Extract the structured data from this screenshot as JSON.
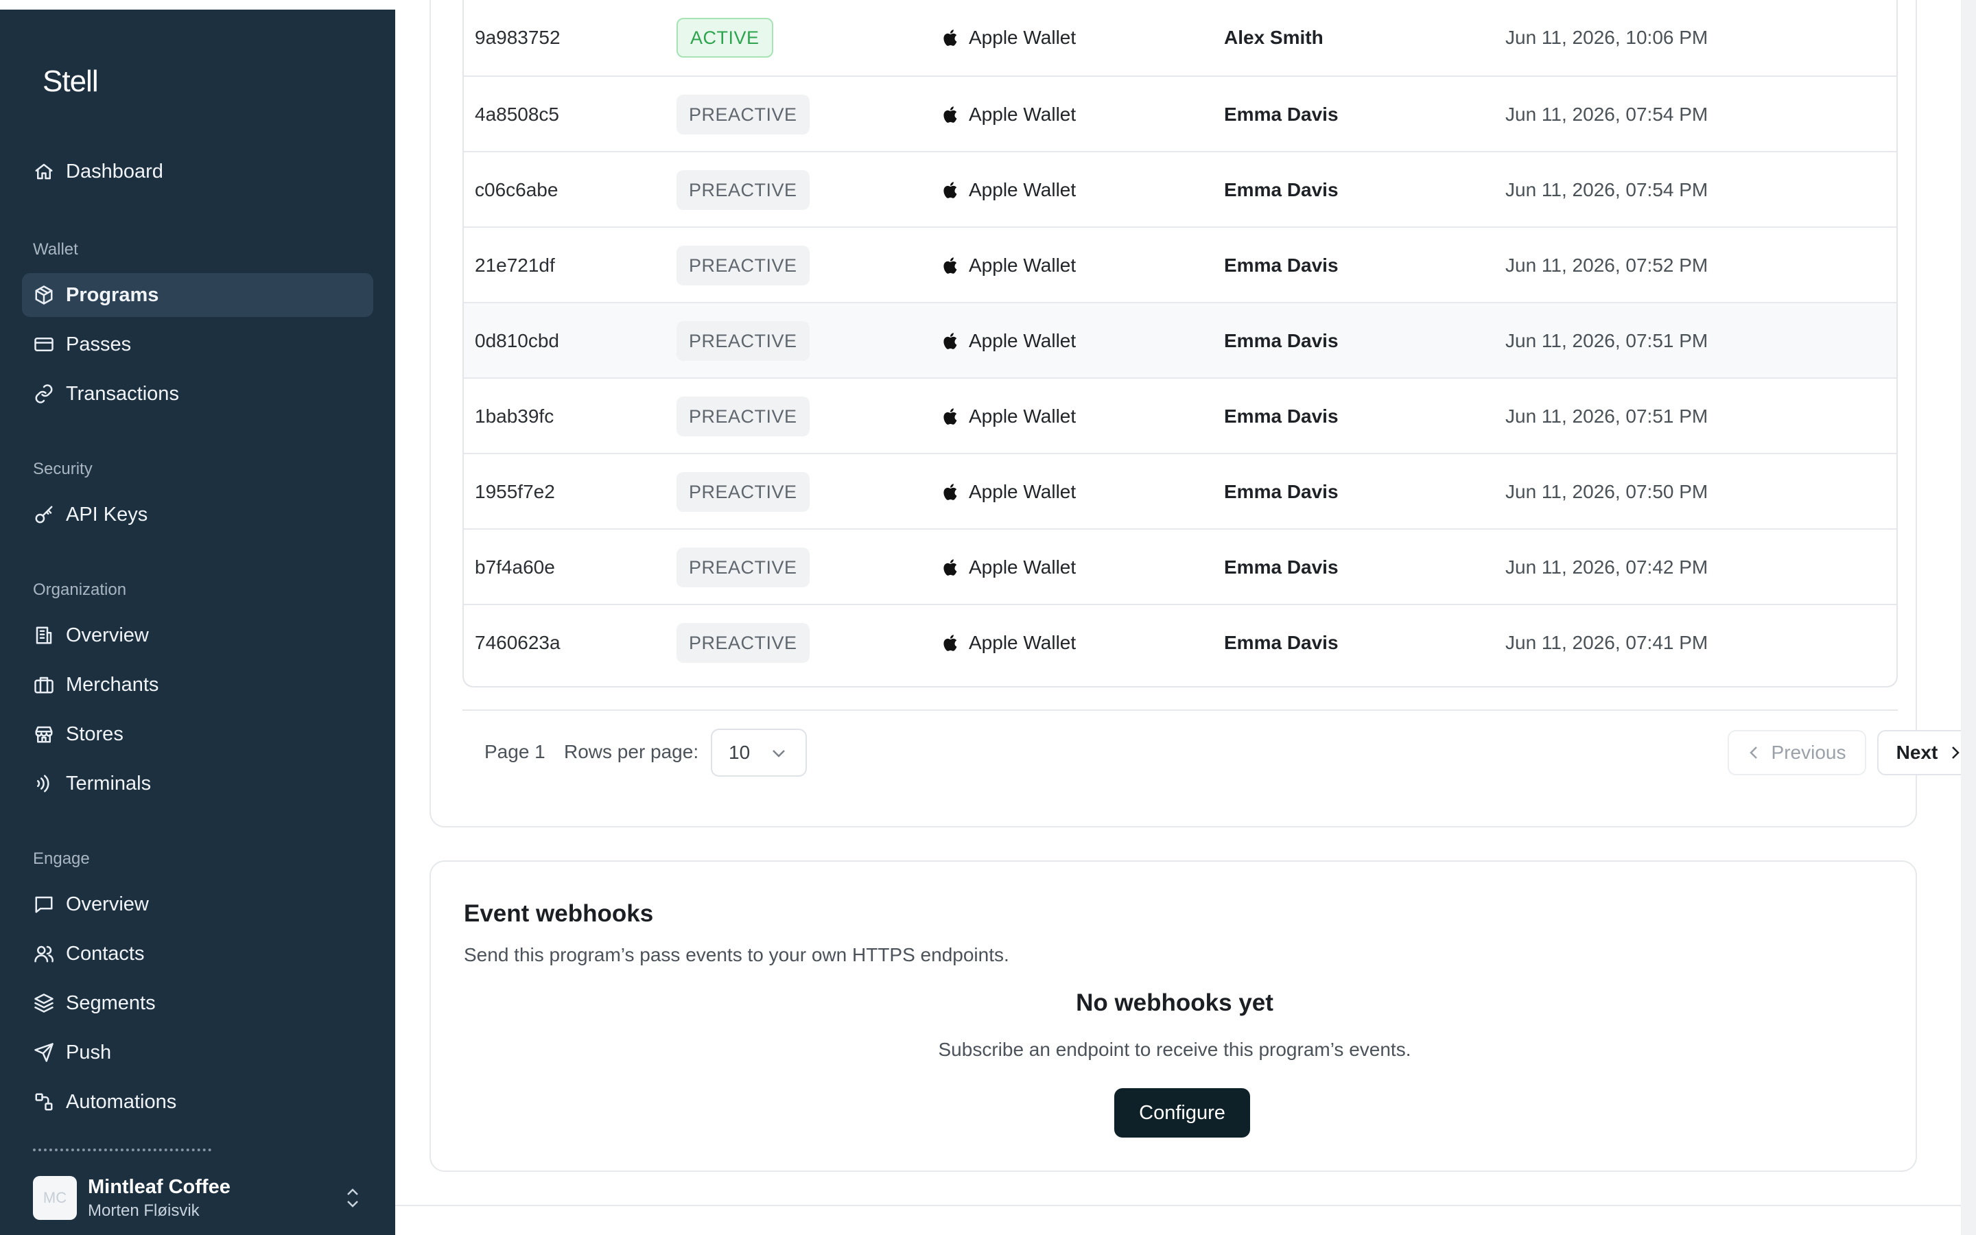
{
  "app": {
    "logo": "Stell"
  },
  "sidebar": {
    "dashboard": "Dashboard",
    "sections": {
      "wallet": "Wallet",
      "security": "Security",
      "organization": "Organization",
      "engage": "Engage"
    },
    "wallet_items": [
      "Programs",
      "Passes",
      "Transactions"
    ],
    "security_items": [
      "API Keys"
    ],
    "organization_items": [
      "Overview",
      "Merchants",
      "Stores",
      "Terminals"
    ],
    "engage_items": [
      "Overview",
      "Contacts",
      "Segments",
      "Push",
      "Automations"
    ],
    "active_item": "Programs"
  },
  "account": {
    "avatar_initials": "MC",
    "name": "Mintleaf Coffee",
    "user": "Morten Fløisvik"
  },
  "table": {
    "rows": [
      {
        "id": "9a983752",
        "status": "ACTIVE",
        "wallet": "Apple Wallet",
        "name": "Alex Smith",
        "date": "Jun 11, 2026, 10:06 PM"
      },
      {
        "id": "4a8508c5",
        "status": "PREACTIVE",
        "wallet": "Apple Wallet",
        "name": "Emma Davis",
        "date": "Jun 11, 2026, 07:54 PM"
      },
      {
        "id": "c06c6abe",
        "status": "PREACTIVE",
        "wallet": "Apple Wallet",
        "name": "Emma Davis",
        "date": "Jun 11, 2026, 07:54 PM"
      },
      {
        "id": "21e721df",
        "status": "PREACTIVE",
        "wallet": "Apple Wallet",
        "name": "Emma Davis",
        "date": "Jun 11, 2026, 07:52 PM"
      },
      {
        "id": "0d810cbd",
        "status": "PREACTIVE",
        "wallet": "Apple Wallet",
        "name": "Emma Davis",
        "date": "Jun 11, 2026, 07:51 PM"
      },
      {
        "id": "1bab39fc",
        "status": "PREACTIVE",
        "wallet": "Apple Wallet",
        "name": "Emma Davis",
        "date": "Jun 11, 2026, 07:51 PM"
      },
      {
        "id": "1955f7e2",
        "status": "PREACTIVE",
        "wallet": "Apple Wallet",
        "name": "Emma Davis",
        "date": "Jun 11, 2026, 07:50 PM"
      },
      {
        "id": "b7f4a60e",
        "status": "PREACTIVE",
        "wallet": "Apple Wallet",
        "name": "Emma Davis",
        "date": "Jun 11, 2026, 07:42 PM"
      },
      {
        "id": "7460623a",
        "status": "PREACTIVE",
        "wallet": "Apple Wallet",
        "name": "Emma Davis",
        "date": "Jun 11, 2026, 07:41 PM"
      }
    ]
  },
  "pagination": {
    "page_label": "Page 1",
    "rows_per_page_label": "Rows per page:",
    "rows_per_page_value": "10",
    "previous_label": "Previous",
    "next_label": "Next"
  },
  "webhooks": {
    "title": "Event webhooks",
    "description": "Send this program’s pass events to your own HTTPS endpoints.",
    "empty_title": "No webhooks yet",
    "empty_description": "Subscribe an endpoint to receive this program’s events.",
    "configure_label": "Configure"
  },
  "colors": {
    "sidebar_bg": "#1d3040",
    "active_badge": "#2ea44f",
    "primary_button": "#0f2128"
  }
}
